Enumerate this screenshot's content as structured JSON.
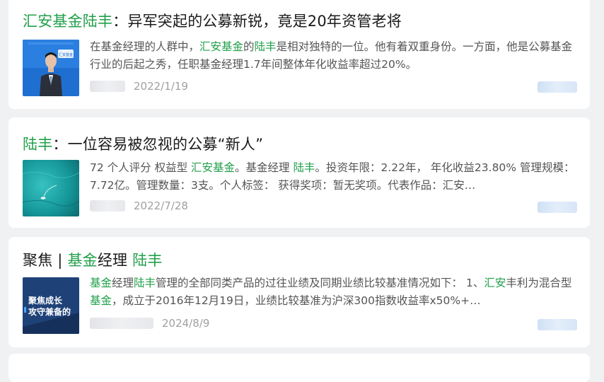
{
  "results": [
    {
      "title": {
        "hl1": "汇安基金陆丰",
        "rest": "：异军突起的公募新锐，竟是20年资管老将"
      },
      "snippet": {
        "p1": "在基金经理的人群中，",
        "hl1": "汇安基金",
        "p2": "的",
        "hl2": "陆丰",
        "p3": "是相对独特的一位。他有着双重身份。一方面，他是公募基金行业的后起之秀，任职基金经理1.7年间整体年化收益率超过20%。"
      },
      "date": "2022/1/19",
      "thumb_caption": "汇安基金"
    },
    {
      "title": {
        "hl1": "陆丰",
        "rest": "：一位容易被忽视的公募“新人”"
      },
      "snippet": {
        "p1": "72 个人评分 权益型 ",
        "hl1": "汇安基金",
        "p2": "。基金经理 ",
        "hl2": "陆丰",
        "p3": "。投资年限：2.22年， 年化收益23.80% 管理规模：7.72亿。管理数量：3支。个人标签： 获得奖项：暂无奖项。代表作品：汇安…"
      },
      "date": "2022/7/28"
    },
    {
      "title": {
        "p1": "聚焦 | ",
        "hl1": "基金",
        "p2": "经理 ",
        "hl2": "陆丰"
      },
      "snippet": {
        "hl1": "基金",
        "p1": "经理",
        "hl2": "陆丰",
        "p2": "管理的全部同类产品的过往业绩及同期业绩比较基准情况如下： 1、",
        "hl3": "汇安",
        "p3": "丰利为混合型",
        "hl4": "基金",
        "p4": "，成立于2016年12月19日，业绩比较基准为沪深300指数收益率x50%+…"
      },
      "date": "2024/8/9",
      "thumb_text": [
        "聚焦成长",
        "攻守兼备的"
      ]
    }
  ],
  "colors": {
    "highlight": "#22a04b",
    "card": "#ffffff",
    "page_bg": "#f0f1f3"
  }
}
